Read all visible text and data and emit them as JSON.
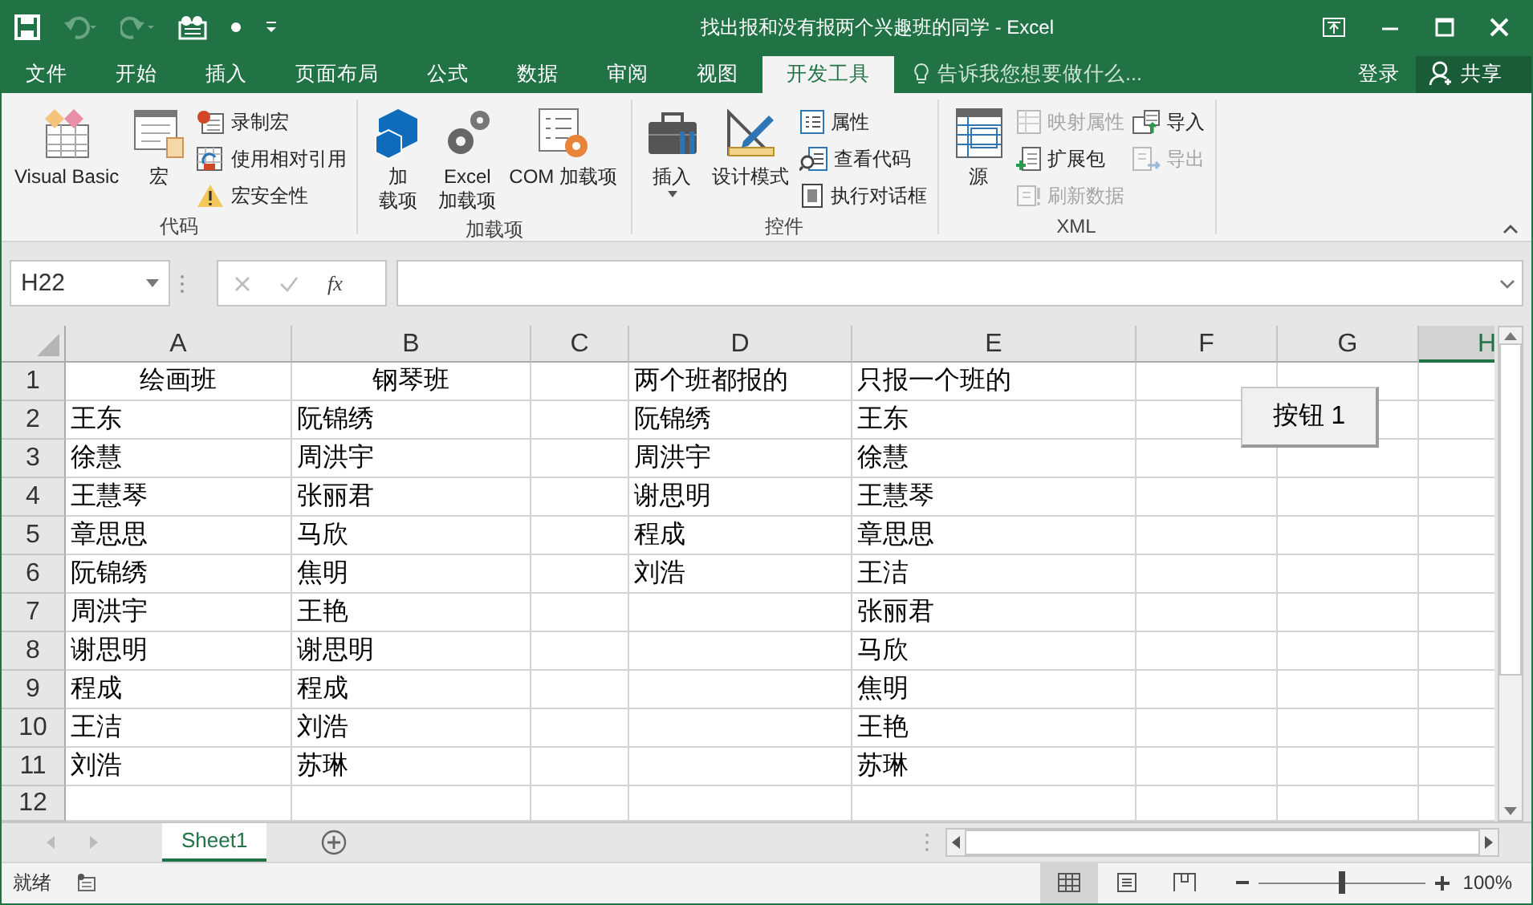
{
  "window": {
    "title": "找出报和没有报两个兴趣班的同学 - Excel"
  },
  "tabs": [
    {
      "label": "文件",
      "selected": false
    },
    {
      "label": "开始",
      "selected": false
    },
    {
      "label": "插入",
      "selected": false
    },
    {
      "label": "页面布局",
      "selected": false
    },
    {
      "label": "公式",
      "selected": false
    },
    {
      "label": "数据",
      "selected": false
    },
    {
      "label": "审阅",
      "selected": false
    },
    {
      "label": "视图",
      "selected": false
    },
    {
      "label": "开发工具",
      "selected": true
    }
  ],
  "tell_me": {
    "placeholder": "告诉我您想要做什么..."
  },
  "account": {
    "sign_in": "登录",
    "share": "共享"
  },
  "ribbon": {
    "groups": [
      {
        "label": "代码",
        "commands": [
          {
            "kind": "large",
            "label": "Visual Basic",
            "disabled": false
          },
          {
            "kind": "large",
            "label": "宏",
            "disabled": false
          },
          {
            "kind": "small",
            "label": "录制宏",
            "disabled": false
          },
          {
            "kind": "small",
            "label": "使用相对引用",
            "disabled": false
          },
          {
            "kind": "small",
            "label": "宏安全性",
            "disabled": false
          }
        ]
      },
      {
        "label": "加载项",
        "commands": [
          {
            "kind": "large",
            "label": "加",
            "label_2": "载项",
            "disabled": false
          },
          {
            "kind": "large",
            "label": "Excel",
            "label_2": "加载项",
            "disabled": false
          },
          {
            "kind": "large",
            "label": "COM 加载项",
            "disabled": false
          }
        ]
      },
      {
        "label": "控件",
        "commands": [
          {
            "kind": "large",
            "label": "插入",
            "disabled": false,
            "dropdown": true
          },
          {
            "kind": "large",
            "label": "设计模式",
            "disabled": false
          },
          {
            "kind": "small",
            "label": "属性",
            "disabled": false
          },
          {
            "kind": "small",
            "label": "查看代码",
            "disabled": false
          },
          {
            "kind": "small",
            "label": "执行对话框",
            "disabled": false
          }
        ]
      },
      {
        "label": "XML",
        "commands": [
          {
            "kind": "large",
            "label": "源",
            "disabled": false
          },
          {
            "kind": "small",
            "label": "映射属性",
            "disabled": true
          },
          {
            "kind": "small",
            "label": "扩展包",
            "disabled": false
          },
          {
            "kind": "small",
            "label": "刷新数据",
            "disabled": true
          },
          {
            "kind": "small",
            "label": "导入",
            "disabled": false
          },
          {
            "kind": "small",
            "label": "导出",
            "disabled": true
          }
        ]
      }
    ]
  },
  "formula_bar": {
    "name_box": "H22",
    "function_symbol": "fx"
  },
  "sheet": {
    "columns": [
      {
        "label": "A",
        "selected": false
      },
      {
        "label": "B",
        "selected": false
      },
      {
        "label": "C",
        "selected": false
      },
      {
        "label": "D",
        "selected": false
      },
      {
        "label": "E",
        "selected": false
      },
      {
        "label": "F",
        "selected": false
      },
      {
        "label": "G",
        "selected": false
      },
      {
        "label": "H",
        "selected": true
      }
    ],
    "rows": [
      {
        "number": "1",
        "cells": [
          {
            "text": "绘画班",
            "centered": true
          },
          {
            "text": "钢琴班",
            "centered": true
          },
          null,
          {
            "text": "两个班都报的",
            "centered": false
          },
          {
            "text": "只报一个班的",
            "centered": false
          }
        ]
      },
      {
        "number": "2",
        "cells": [
          "王东",
          "阮锦绣",
          null,
          "阮锦绣",
          "王东"
        ]
      },
      {
        "number": "3",
        "cells": [
          "徐慧",
          "周洪宇",
          null,
          "周洪宇",
          "徐慧"
        ]
      },
      {
        "number": "4",
        "cells": [
          "王慧琴",
          "张丽君",
          null,
          "谢思明",
          "王慧琴"
        ]
      },
      {
        "number": "5",
        "cells": [
          "章思思",
          "马欣",
          null,
          "程成",
          "章思思"
        ]
      },
      {
        "number": "6",
        "cells": [
          "阮锦绣",
          "焦明",
          null,
          "刘浩",
          "王洁"
        ]
      },
      {
        "number": "7",
        "cells": [
          "周洪宇",
          "王艳",
          null,
          null,
          "张丽君"
        ]
      },
      {
        "number": "8",
        "cells": [
          "谢思明",
          "谢思明",
          null,
          null,
          "马欣"
        ]
      },
      {
        "number": "9",
        "cells": [
          "程成",
          "程成",
          null,
          null,
          "焦明"
        ]
      },
      {
        "number": "10",
        "cells": [
          "王洁",
          "刘浩",
          null,
          null,
          "王艳"
        ]
      },
      {
        "number": "11",
        "cells": [
          "刘浩",
          "苏琳",
          null,
          null,
          "苏琳"
        ]
      },
      {
        "number": "12"
      }
    ],
    "form_button": {
      "label": "按钮 1"
    }
  },
  "sheet_tabs": [
    {
      "label": "Sheet1",
      "selected": true
    }
  ],
  "status_bar": {
    "status": "就绪",
    "views": [
      {
        "kind": "normal",
        "selected": true
      },
      {
        "kind": "page_layout",
        "selected": false
      },
      {
        "kind": "page_break",
        "selected": false
      }
    ],
    "zoom": {
      "level": 0.5,
      "reading": "100%"
    }
  }
}
